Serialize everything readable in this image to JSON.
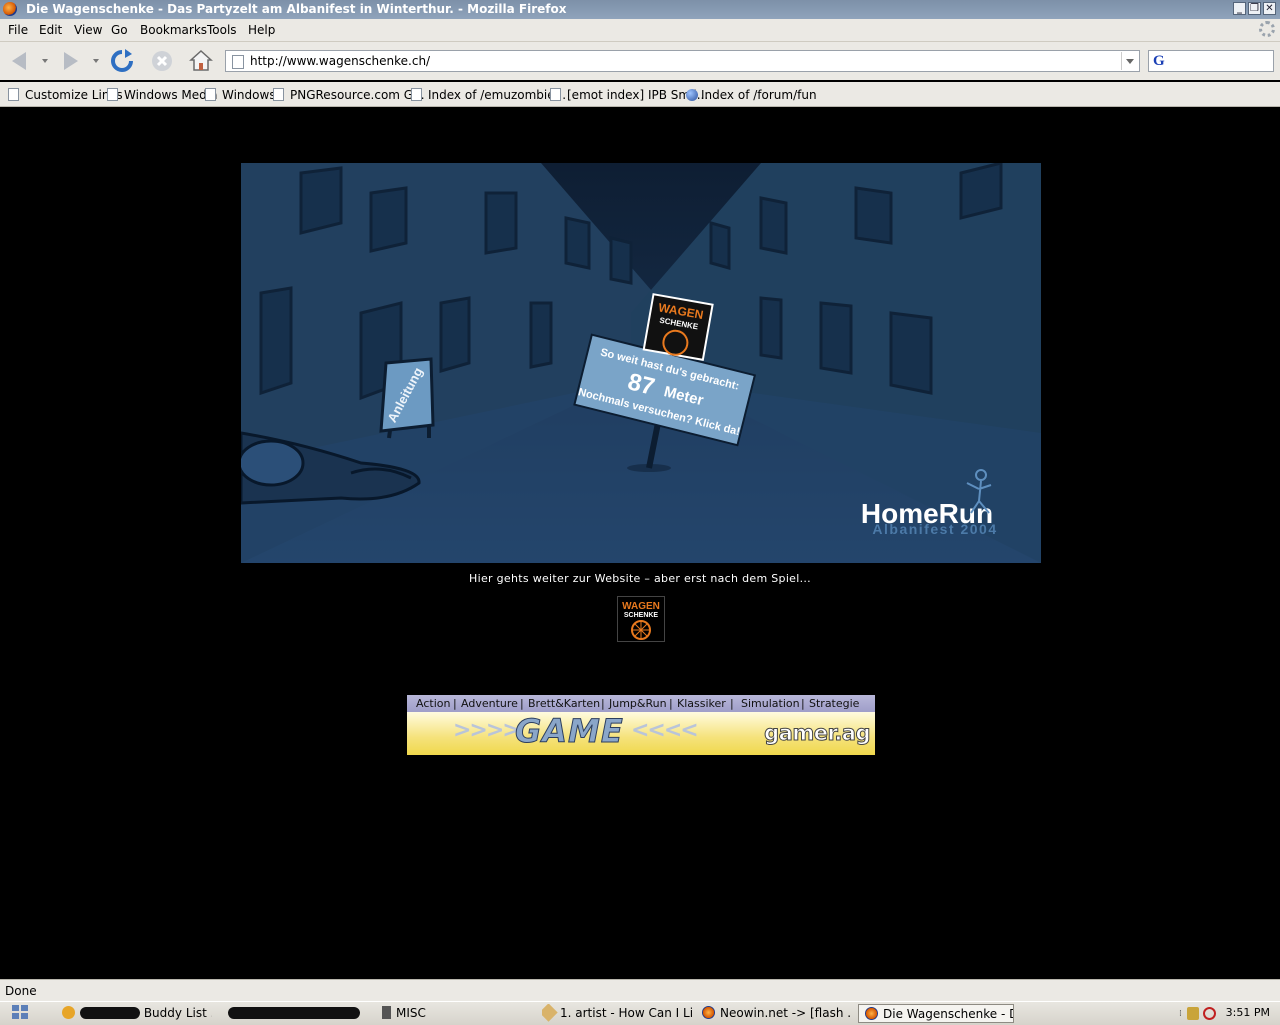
{
  "window": {
    "title": "Die Wagenschenke - Das Partyzelt am Albanifest in Winterthur. - Mozilla Firefox",
    "controls": [
      "_",
      "❐",
      "✕"
    ]
  },
  "menu": [
    "File",
    "Edit",
    "View",
    "Go",
    "Bookmarks",
    "Tools",
    "Help"
  ],
  "navigation": {
    "url": "http://www.wagenschenke.ch/",
    "search_engine_icon": "G"
  },
  "bookmarks": [
    "Customize Links",
    "Windows Media",
    "Windows",
    "PNGResource.com G...",
    "Index of /emuzombie...",
    "[emot index] IPB Smil...",
    "Index of /forum/fun"
  ],
  "game": {
    "logo_line1": "WAGEN",
    "logo_line2": "SCHENKE",
    "sign_line1": "So weit hast du's gebracht:",
    "distance_number": "87",
    "distance_unit": "Meter",
    "sign_line3": "Nochmals versuchen? Klick da!",
    "instructions_sign": "Anleitung",
    "title": "HomeRun",
    "subtitle": "Albanifest 2004"
  },
  "caption": "Hier gehts weiter zur Website – aber erst nach dem Spiel...",
  "banner": {
    "categories": [
      "Action",
      "Adventure",
      "Brett&Karten",
      "Jump&Run",
      "Klassiker",
      "Simulation",
      "Strategie"
    ],
    "arrows_left": ">>>>",
    "word": "GAME",
    "arrows_right": "<<<<",
    "brand": "gamer.ag"
  },
  "status": "Done",
  "taskbar": {
    "tasks": [
      "Buddy List ...",
      "MISC",
      "1. artist - How Can I Li...",
      "Neowin.net -> [flash ...",
      "Die Wagenschenke - D..."
    ],
    "clock": "3:51 PM"
  },
  "colors": {
    "game_background": "#1c3550",
    "sign": "#7aa4c8",
    "logo_orange": "#e8791e"
  }
}
